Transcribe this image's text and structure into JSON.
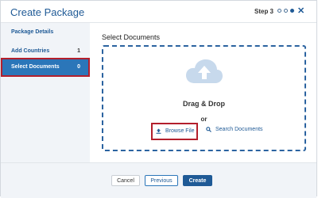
{
  "dialog": {
    "title": "Create Package",
    "step_label": "Step 3",
    "step_dots": [
      "empty",
      "empty",
      "filled"
    ],
    "close_glyph": "✕"
  },
  "sidebar": {
    "items": [
      {
        "label": "Package Details",
        "count": "",
        "active": false
      },
      {
        "label": "Add Countries",
        "count": "1",
        "active": false
      },
      {
        "label": "Select Documents",
        "count": "0",
        "active": true
      }
    ]
  },
  "main": {
    "title": "Select Documents",
    "dropzone": {
      "icon": "cloud-upload-icon",
      "drag_text": "Drag & Drop",
      "or_text": "or",
      "browse_label": "Browse File",
      "browse_icon": "upload-icon",
      "search_label": "Search Documents",
      "search_icon": "search-icon"
    }
  },
  "footer": {
    "cancel_label": "Cancel",
    "previous_label": "Previous",
    "create_label": "Create"
  },
  "colors": {
    "accent": "#1f5a96",
    "active_bg": "#2b76b9",
    "highlight_border": "#b31f2c"
  }
}
